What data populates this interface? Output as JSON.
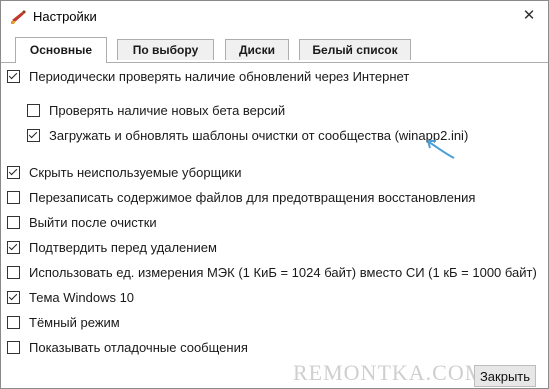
{
  "window": {
    "title": "Настройки"
  },
  "tabs": [
    {
      "label": "Основные",
      "active": true
    },
    {
      "label": "По выбору",
      "active": false
    },
    {
      "label": "Диски",
      "active": false
    },
    {
      "label": "Белый список",
      "active": false
    }
  ],
  "options": [
    {
      "label": "Периодически проверять наличие обновлений через Интернет",
      "checked": true
    },
    {
      "label": "Проверять наличие новых бета версий",
      "checked": false
    },
    {
      "label": "Загружать и обновлять шаблоны очистки от сообщества (winapp2.ini)",
      "checked": true
    },
    {
      "label": "Скрыть неиспользуемые уборщики",
      "checked": true
    },
    {
      "label": "Перезаписать содержимое файлов для предотвращения восстановления",
      "checked": false
    },
    {
      "label": "Выйти после очистки",
      "checked": false
    },
    {
      "label": "Подтвердить перед удалением",
      "checked": true
    },
    {
      "label": "Использовать ед. измерения МЭК (1 КиБ = 1024 байт) вместо СИ (1 кБ = 1000 байт)",
      "checked": false
    },
    {
      "label": "Тема Windows 10",
      "checked": true
    },
    {
      "label": "Тёмный режим",
      "checked": false
    },
    {
      "label": "Показывать отладочные сообщения",
      "checked": false
    }
  ],
  "footer": {
    "close_label": "Закрыть",
    "watermark": "REMONTKA.COM"
  },
  "colors": {
    "arrow": "#4a9fd8"
  }
}
